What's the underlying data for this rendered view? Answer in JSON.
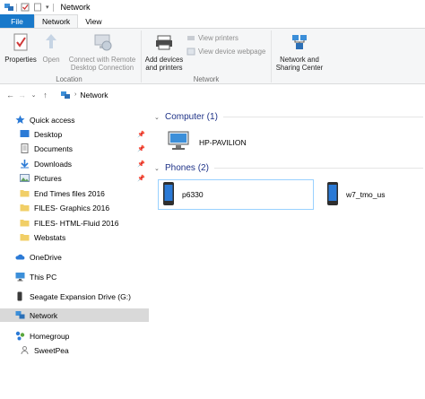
{
  "window": {
    "title": "Network"
  },
  "tabs": {
    "file": "File",
    "network": "Network",
    "view": "View"
  },
  "ribbon": {
    "properties": "Properties",
    "open": "Open",
    "connect_line1": "Connect with Remote",
    "connect_line2": "Desktop Connection",
    "location_group": "Location",
    "add_devices_line1": "Add devices",
    "add_devices_line2": "and printers",
    "view_printers": "View printers",
    "view_device_webpage": "View device webpage",
    "network_group": "Network",
    "nsc_line1": "Network and",
    "nsc_line2": "Sharing Center"
  },
  "address": {
    "crumb": "Network"
  },
  "nav": {
    "quick_access": "Quick access",
    "desktop": "Desktop",
    "documents": "Documents",
    "downloads": "Downloads",
    "pictures": "Pictures",
    "folder1": "End Times files 2016",
    "folder2": "FILES- Graphics 2016",
    "folder3": "FILES- HTML-Fluid 2016",
    "folder4": "Webstats",
    "onedrive": "OneDrive",
    "thispc": "This PC",
    "seagate": "Seagate Expansion Drive (G:)",
    "network": "Network",
    "homegroup": "Homegroup",
    "sweetpea": "SweetPea"
  },
  "content": {
    "computer_header": "Computer (1)",
    "computer_name": "HP-PAVILION",
    "phones_header": "Phones (2)",
    "phone1": "p6330",
    "phone2": "w7_tmo_us"
  },
  "colors": {
    "file_tab": "#1979ca",
    "header_text": "#1e3287",
    "selection": "#d9d9d9",
    "selected_border": "#99d1ff"
  }
}
